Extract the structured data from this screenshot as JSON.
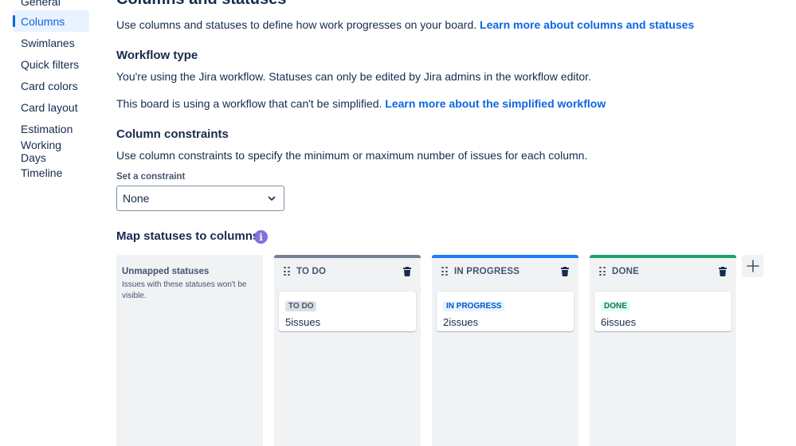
{
  "sidebar": {
    "items": [
      {
        "label": "General"
      },
      {
        "label": "Columns",
        "selected": true
      },
      {
        "label": "Swimlanes"
      },
      {
        "label": "Quick filters"
      },
      {
        "label": "Card colors"
      },
      {
        "label": "Card layout"
      },
      {
        "label": "Estimation"
      },
      {
        "label": "Working Days"
      },
      {
        "label": "Timeline"
      }
    ]
  },
  "main": {
    "title": "Columns and statuses",
    "intro_text": "Use columns and statuses to define how work progresses on your board.",
    "intro_link": "Learn more about columns and statuses",
    "workflow_heading": "Workflow type",
    "workflow_text": "You're using the Jira workflow. Statuses can only be edited by Jira admins in the workflow editor.",
    "simplified_text": "This board is using a workflow that can't be simplified.",
    "simplified_link": "Learn more about the simplified workflow",
    "constraints_heading": "Column constraints",
    "constraints_text": "Use column constraints to specify the minimum or maximum number of issues for each column.",
    "constraint_label": "Set a constraint",
    "constraint_value": "None",
    "map_heading": "Map statuses to columns",
    "info_icon_glyph": "i"
  },
  "board": {
    "unmapped": {
      "title": "Unmapped statuses",
      "description": "Issues with these statuses won't be visible."
    },
    "columns": [
      {
        "name": "TO DO",
        "accent": "#758195",
        "status": "TO DO",
        "status_bg": "#dcdfe4",
        "status_fg": "#44546f",
        "count": "5",
        "unit": "issues"
      },
      {
        "name": "IN PROGRESS",
        "accent": "#1d7afc",
        "status": "IN PROGRESS",
        "status_bg": "#e9f2ff",
        "status_fg": "#0055cc",
        "count": "2",
        "unit": "issues"
      },
      {
        "name": "DONE",
        "accent": "#22a06b",
        "status": "DONE",
        "status_bg": "#dcfff1",
        "status_fg": "#216e4e",
        "count": "6",
        "unit": "issues"
      }
    ]
  },
  "colors": {
    "accent": "#0c66e4",
    "info_icon": "#8270db"
  },
  "icons": [
    "chevron-down-icon",
    "info-icon",
    "drag-handle-icon",
    "trash-icon",
    "plus-icon"
  ]
}
